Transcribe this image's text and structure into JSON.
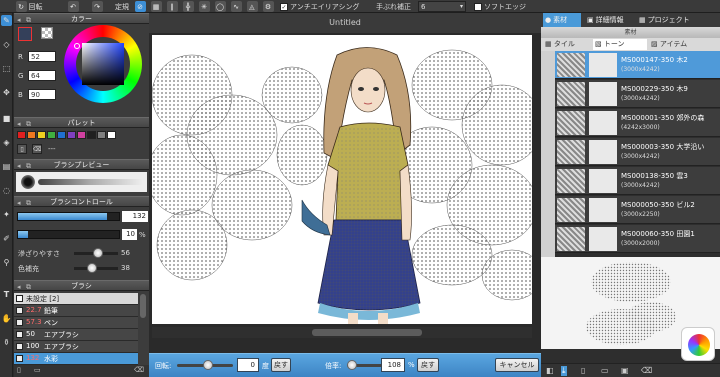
{
  "topbar": {
    "buttons": [
      "回転",
      "定規"
    ],
    "antialias_label": "アンチエイリアシング",
    "stabilizer_label": "手ぶれ補正",
    "stabilizer_value": "6",
    "soft_edge_label": "ソフトエッジ",
    "canvas_title": "Untitled"
  },
  "left_panel": {
    "color_title": "カラー",
    "r_label": "R",
    "r_value": "52",
    "g_label": "G",
    "g_value": "64",
    "b_label": "B",
    "b_value": "90",
    "palette_title": "パレット",
    "palette_more": "---",
    "brush_preview_title": "ブラシプレビュー",
    "brush_control_title": "ブラシコントロール",
    "size_value": "132",
    "opacity_value": "10",
    "opacity_unit": "%",
    "blur_label": "滲ざりやすさ",
    "blur_value": "56",
    "color_fill_label": "色補充",
    "color_fill_value": "38",
    "brush_title": "ブラシ",
    "brushes": [
      {
        "size": "",
        "name": "未設定 [2]"
      },
      {
        "size": "22.7",
        "name": "鉛筆"
      },
      {
        "size": "57.3",
        "name": "ペン"
      },
      {
        "size": "50",
        "name": "エアブラシ"
      },
      {
        "size": "100",
        "name": "エアブラシ"
      },
      {
        "size": "132",
        "name": "水彩"
      }
    ]
  },
  "bottombar": {
    "rotate_label": "回転:",
    "rotate_value": "0",
    "rotate_unit": "度",
    "rotate_reset": "戻す",
    "zoom_label": "倍率:",
    "zoom_value": "108",
    "zoom_unit": "%",
    "zoom_reset": "戻す",
    "cancel": "キャンセル"
  },
  "right_panel": {
    "tabs": [
      "素材",
      "詳細情報",
      "プロジェクト"
    ],
    "material_header": "素材",
    "sub_tabs": [
      "タイル",
      "トーン",
      "アイテム"
    ],
    "materials": [
      {
        "name": "MS000147-350 木2",
        "size": "(3000x4242)"
      },
      {
        "name": "MS000229-350 木9",
        "size": "(3000x4242)"
      },
      {
        "name": "MS000001-350 郊外の森",
        "size": "(4242x3000)"
      },
      {
        "name": "MS000003-350 大学沿い",
        "size": "(3000x4242)"
      },
      {
        "name": "MS000138-350 雲3",
        "size": "(3000x4242)"
      },
      {
        "name": "MS000050-350 ビル2",
        "size": "(3000x2250)"
      },
      {
        "name": "MS000060-350 田園1",
        "size": "(3000x2000)"
      }
    ]
  },
  "colors": {
    "accent": "#3d8fd6",
    "current_color": "#34405a",
    "palette": [
      "#e02020",
      "#f07820",
      "#f0d020",
      "#40b040",
      "#2070d0",
      "#8040c0",
      "#d040a0",
      "#202020",
      "#808080",
      "#ffffff"
    ]
  }
}
